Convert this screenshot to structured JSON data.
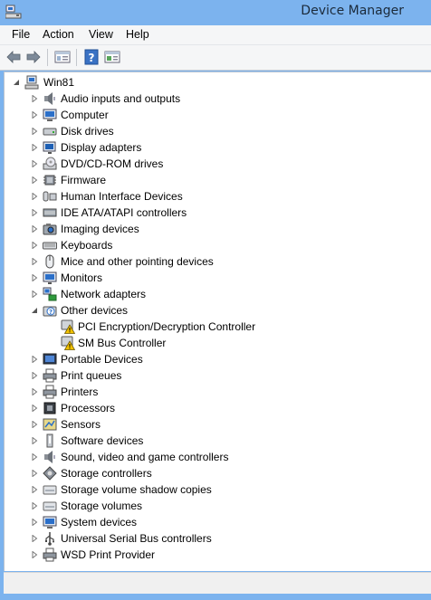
{
  "window": {
    "title": "Device Manager",
    "icon": "device-manager-icon"
  },
  "menu": {
    "items": [
      "File",
      "Action",
      "View",
      "Help"
    ]
  },
  "toolbar": {
    "buttons": [
      "back-arrow-icon",
      "forward-arrow-icon",
      "properties-icon",
      "help-icon",
      "view-icon"
    ]
  },
  "tree": {
    "root": "Win81",
    "categories": [
      {
        "label": "Audio inputs and outputs",
        "icon": "speaker-icon"
      },
      {
        "label": "Computer",
        "icon": "computer-icon"
      },
      {
        "label": "Disk drives",
        "icon": "disk-icon"
      },
      {
        "label": "Display adapters",
        "icon": "display-icon"
      },
      {
        "label": "DVD/CD-ROM drives",
        "icon": "dvd-icon"
      },
      {
        "label": "Firmware",
        "icon": "firmware-icon"
      },
      {
        "label": "Human Interface Devices",
        "icon": "hid-icon"
      },
      {
        "label": "IDE ATA/ATAPI controllers",
        "icon": "ide-icon"
      },
      {
        "label": "Imaging devices",
        "icon": "camera-icon"
      },
      {
        "label": "Keyboards",
        "icon": "keyboard-icon"
      },
      {
        "label": "Mice and other pointing devices",
        "icon": "mouse-icon"
      },
      {
        "label": "Monitors",
        "icon": "monitor-icon"
      },
      {
        "label": "Network adapters",
        "icon": "network-icon"
      },
      {
        "label": "Other devices",
        "icon": "unknown-device-icon",
        "expanded": true,
        "children": [
          {
            "label": "PCI Encryption/Decryption Controller",
            "icon": "warning-device-icon"
          },
          {
            "label": "SM Bus Controller",
            "icon": "warning-device-icon"
          }
        ]
      },
      {
        "label": "Portable Devices",
        "icon": "portable-icon"
      },
      {
        "label": "Print queues",
        "icon": "printer-icon"
      },
      {
        "label": "Printers",
        "icon": "printer-icon"
      },
      {
        "label": "Processors",
        "icon": "processor-icon"
      },
      {
        "label": "Sensors",
        "icon": "sensor-icon"
      },
      {
        "label": "Software devices",
        "icon": "software-icon"
      },
      {
        "label": "Sound, video and game controllers",
        "icon": "speaker-icon"
      },
      {
        "label": "Storage controllers",
        "icon": "storage-controller-icon"
      },
      {
        "label": "Storage volume shadow copies",
        "icon": "volume-icon"
      },
      {
        "label": "Storage volumes",
        "icon": "volume-icon"
      },
      {
        "label": "System devices",
        "icon": "system-icon"
      },
      {
        "label": "Universal Serial Bus controllers",
        "icon": "usb-icon"
      },
      {
        "label": "WSD Print Provider",
        "icon": "printer-icon"
      }
    ]
  },
  "colors": {
    "frame": "#7cb3ee",
    "warning": "#f2c200"
  }
}
